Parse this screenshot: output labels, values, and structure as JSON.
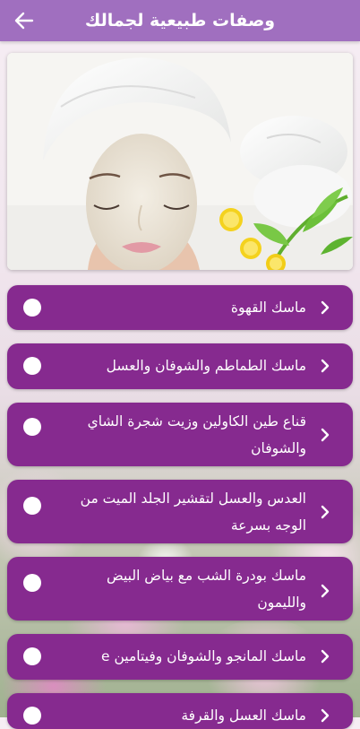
{
  "header": {
    "title": "وصفات طبيعية لجمالك",
    "back_icon": "arrow-back-icon"
  },
  "hero": {
    "image": "woman with white face mask and towel turban beside lemon slices and green leaves"
  },
  "colors": {
    "appbar": "#a06fbf",
    "item": "#862a8f",
    "radio": "#ffffff"
  },
  "recipes": [
    {
      "label": "ماسك القهوة"
    },
    {
      "label": "ماسك الطماطم والشوفان والعسل"
    },
    {
      "label": "قناع طين الكاولين وزيت شجرة الشاي والشوفان"
    },
    {
      "label": "العدس والعسل لتقشير الجلد الميت من الوجه بسرعة"
    },
    {
      "label": "ماسك بودرة الشب مع بياض البيض والليمون"
    },
    {
      "label": "ماسك المانجو والشوفان وفيتامين e"
    },
    {
      "label": "ماسك العسل والقرفة"
    }
  ]
}
